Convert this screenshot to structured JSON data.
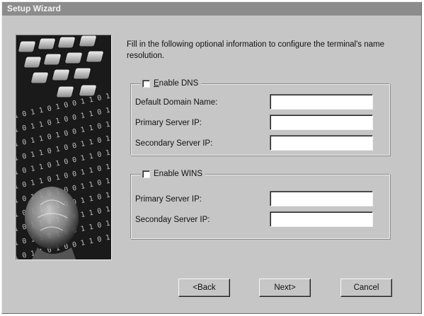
{
  "window": {
    "title": "Setup Wizard",
    "intro_text": "Fill in the following optional information to configure the terminal's name resolution."
  },
  "dns": {
    "checkbox_label": "Enable DNS",
    "checked": false,
    "domain_label": "Default Domain Name:",
    "domain_value": "",
    "primary_label": "Primary Server IP:",
    "primary_value": "",
    "secondary_label": "Secondary Server IP:",
    "secondary_value": ""
  },
  "wins": {
    "checkbox_label": "Enable WINS",
    "checked": false,
    "primary_label": "Primary Server IP:",
    "primary_value": "",
    "secondary_label": "Seconday Server IP:",
    "secondary_value": ""
  },
  "buttons": {
    "back": "<Back",
    "next": "Next>",
    "cancel": "Cancel"
  },
  "colors": {
    "dialog_face": "#c6c6c6",
    "title_bar": "#8c8c8c",
    "banner_background": "#171717"
  },
  "banner": {
    "digit_text": "1 0 1 1 0 1 0 0 1 1 0 1 0 1 1 0 0 1 0 1 1 1 0 1 0 0 1 0 1 1 0 1"
  }
}
